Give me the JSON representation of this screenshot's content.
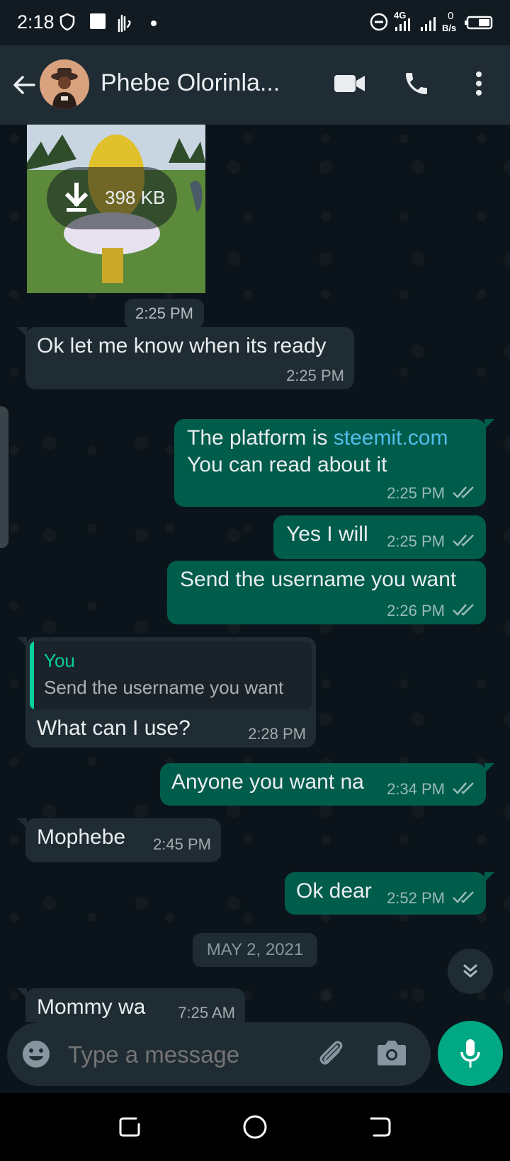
{
  "status_bar": {
    "time": "2:18",
    "network": "4G",
    "data_speed_value": "0",
    "data_speed_unit": "B/s"
  },
  "header": {
    "contact_name": "Phebe Olorinla..."
  },
  "messages": {
    "image": {
      "size": "398 KB",
      "time": "2:25 PM"
    },
    "m1": {
      "text": "Ok let me know when its ready",
      "time": "2:25 PM"
    },
    "m2": {
      "line1_prefix": "The platform is ",
      "link": "steemit.com",
      "line2": "You can read about it",
      "time": "2:25 PM"
    },
    "m3": {
      "text": "Yes I will",
      "time": "2:25 PM"
    },
    "m4": {
      "text": "Send the username you want",
      "time": "2:26 PM"
    },
    "m5": {
      "quote_author": "You",
      "quote_text": "Send the username you want",
      "text": "What can I use?",
      "time": "2:28 PM"
    },
    "m6": {
      "text": "Anyone you want na",
      "time": "2:34 PM"
    },
    "m7": {
      "text": "Mophebe",
      "time": "2:45 PM"
    },
    "m8": {
      "text": "Ok dear",
      "time": "2:52 PM"
    },
    "date_divider": "MAY 2, 2021",
    "m9": {
      "text": "Mommy wa",
      "time": "7:25 AM"
    }
  },
  "composer": {
    "placeholder": "Type a message"
  },
  "colors": {
    "background": "#0b141a",
    "header": "#1f2c34",
    "incoming_bubble": "#1f2c33",
    "outgoing_bubble": "#005c4b",
    "accent": "#00a884",
    "link": "#53bdeb",
    "quote_author": "#06cf9c"
  },
  "icons": [
    "back-arrow-icon",
    "video-call-icon",
    "phone-icon",
    "more-options-icon",
    "download-icon",
    "double-check-icon",
    "emoji-icon",
    "attach-icon",
    "camera-icon",
    "mic-icon",
    "scroll-down-icon"
  ]
}
